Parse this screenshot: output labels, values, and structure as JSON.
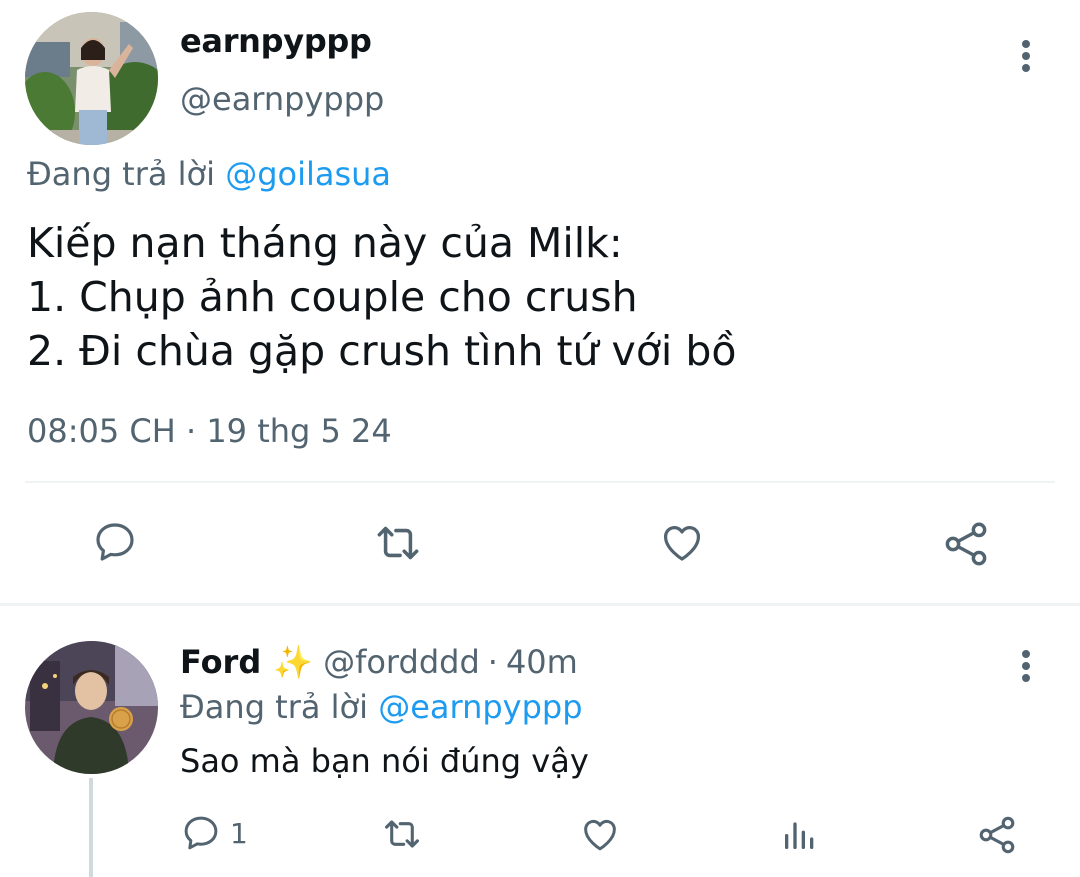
{
  "main_tweet": {
    "display_name": "earnpyppp",
    "handle": "@earnpyppp",
    "replying_prefix": "Đang trả lời",
    "replying_to": "@goilasua",
    "text_lines": [
      "Kiếp nạn tháng này của Milk:",
      "1. Chụp ảnh couple cho crush",
      "2. Đi chùa gặp crush tình tứ với bồ"
    ],
    "timestamp": "08:05 CH · 19 thg 5 24",
    "actions": [
      "reply-icon",
      "retweet-icon",
      "like-icon",
      "share-icon"
    ]
  },
  "reply_tweet": {
    "display_name": "Ford",
    "emoji": "✨",
    "handle": "@fordddd",
    "separator": "·",
    "time": "40m",
    "replying_prefix": "Đang trả lời",
    "replying_to": "@earnpyppp",
    "text": "Sao mà bạn nói đúng vậy",
    "reply_count": "1",
    "actions": [
      "reply-icon",
      "retweet-icon",
      "like-icon",
      "stats-icon",
      "share-icon"
    ]
  },
  "colors": {
    "text_primary": "#0f1419",
    "text_secondary": "#536471",
    "link": "#1d9bf0",
    "divider": "#eff3f4",
    "thread_line": "#cfd9de"
  }
}
